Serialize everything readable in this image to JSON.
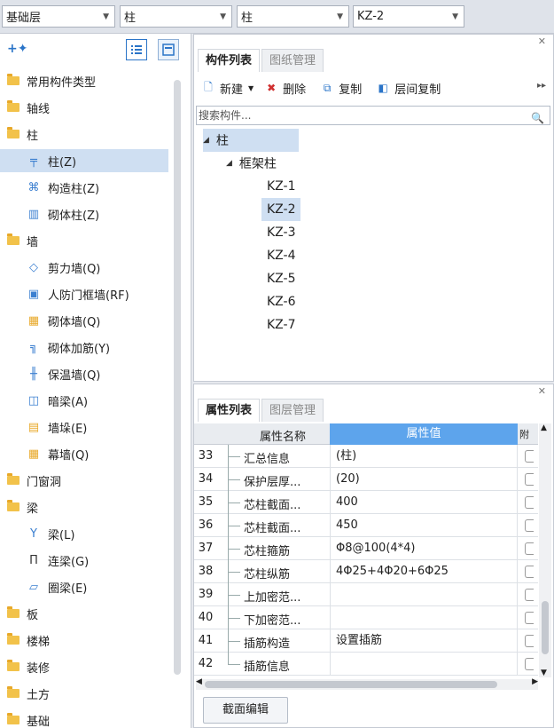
{
  "selectors": [
    {
      "value": "基础层"
    },
    {
      "value": "柱"
    },
    {
      "value": "柱"
    },
    {
      "value": "KZ-2"
    }
  ],
  "left_tree": {
    "items": [
      {
        "label": "常用构件类型"
      },
      {
        "label": "轴线"
      },
      {
        "label": "柱"
      },
      {
        "label": "柱(Z)"
      },
      {
        "label": "构造柱(Z)"
      },
      {
        "label": "砌体柱(Z)"
      },
      {
        "label": "墙"
      },
      {
        "label": "剪力墙(Q)"
      },
      {
        "label": "人防门框墙(RF)"
      },
      {
        "label": "砌体墙(Q)"
      },
      {
        "label": "砌体加筋(Y)"
      },
      {
        "label": "保温墙(Q)"
      },
      {
        "label": "暗梁(A)"
      },
      {
        "label": "墙垛(E)"
      },
      {
        "label": "幕墙(Q)"
      },
      {
        "label": "门窗洞"
      },
      {
        "label": "梁"
      },
      {
        "label": "梁(L)"
      },
      {
        "label": "连梁(G)"
      },
      {
        "label": "圈梁(E)"
      },
      {
        "label": "板"
      },
      {
        "label": "楼梯"
      },
      {
        "label": "装修"
      },
      {
        "label": "土方"
      },
      {
        "label": "基础"
      }
    ]
  },
  "component_panel": {
    "tabs": [
      "构件列表",
      "图纸管理"
    ],
    "toolbar": {
      "new": "新建",
      "delete": "删除",
      "copy": "复制",
      "floor_copy": "层间复制"
    },
    "search_placeholder": "搜索构件...",
    "tree": {
      "root": "柱",
      "group": "框架柱",
      "items": [
        "KZ-1",
        "KZ-2",
        "KZ-3",
        "KZ-4",
        "KZ-5",
        "KZ-6",
        "KZ-7"
      ]
    }
  },
  "property_panel": {
    "tabs": [
      "属性列表",
      "图层管理"
    ],
    "columns": {
      "name": "属性名称",
      "value": "属性值",
      "extra": "附"
    },
    "rows": [
      {
        "num": "33",
        "name": "汇总信息",
        "value": "(柱)"
      },
      {
        "num": "34",
        "name": "保护层厚...",
        "value": "(20)"
      },
      {
        "num": "35",
        "name": "芯柱截面...",
        "value": "400"
      },
      {
        "num": "36",
        "name": "芯柱截面...",
        "value": "450"
      },
      {
        "num": "37",
        "name": "芯柱箍筋",
        "value": "Φ8@100(4*4)"
      },
      {
        "num": "38",
        "name": "芯柱纵筋",
        "value": "4Φ25+4Φ20+6Φ25"
      },
      {
        "num": "39",
        "name": "上加密范...",
        "value": ""
      },
      {
        "num": "40",
        "name": "下加密范...",
        "value": ""
      },
      {
        "num": "41",
        "name": "插筋构造",
        "value": "设置插筋"
      },
      {
        "num": "42",
        "name": "插筋信息",
        "value": ""
      }
    ],
    "section_edit_button": "截面编辑"
  }
}
